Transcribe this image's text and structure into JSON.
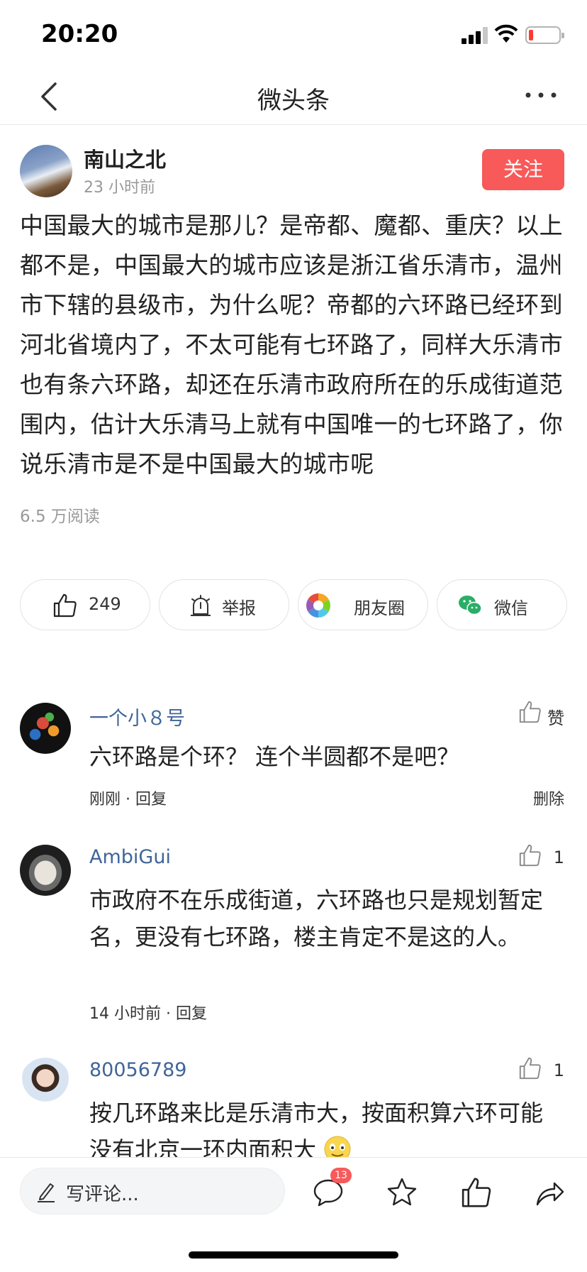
{
  "status_bar": {
    "time": "20:20"
  },
  "nav": {
    "title": "微头条"
  },
  "post": {
    "author_name": "南山之北",
    "posted_time": "23 小时前",
    "follow_label": "关注",
    "body": "中国最大的城市是那儿？是帝都、魔都、重庆？以上都不是，中国最大的城市应该是浙江省乐清市，温州市下辖的县级市，为什么呢？帝都的六环路已经环到河北省境内了，不太可能有七环路了，同样大乐清市也有条六环路，却还在乐清市政府所在的乐成街道范围内，估计大乐清马上就有中国唯一的七环路了，你说乐清市是不是中国最大的城市呢",
    "reads": "6.5 万阅读"
  },
  "actions": {
    "like_count": "249",
    "report_label": "举报",
    "moments_label": "朋友圈",
    "wechat_label": "微信"
  },
  "comments": [
    {
      "name": "一个小８号",
      "like": "赞",
      "text": "六环路是个环？ 连个半圆都不是吧？",
      "meta": "刚刚 · 回复",
      "delete": "删除"
    },
    {
      "name": "AmbiGui",
      "like": "1",
      "text": "市政府不在乐成街道，六环路也只是规划暂定名，更没有七环路，楼主肯定不是这的人。",
      "meta": "14 小时前 · 回复"
    },
    {
      "name": "80056789",
      "like": "1",
      "text": "按几环路来比是乐清市大，按面积算六环可能没有北京一环内面积大"
    }
  ],
  "bottom_bar": {
    "write_placeholder": "写评论...",
    "comment_badge": "13"
  },
  "colors": {
    "accent_red": "#f85959",
    "username_blue": "#406599"
  }
}
